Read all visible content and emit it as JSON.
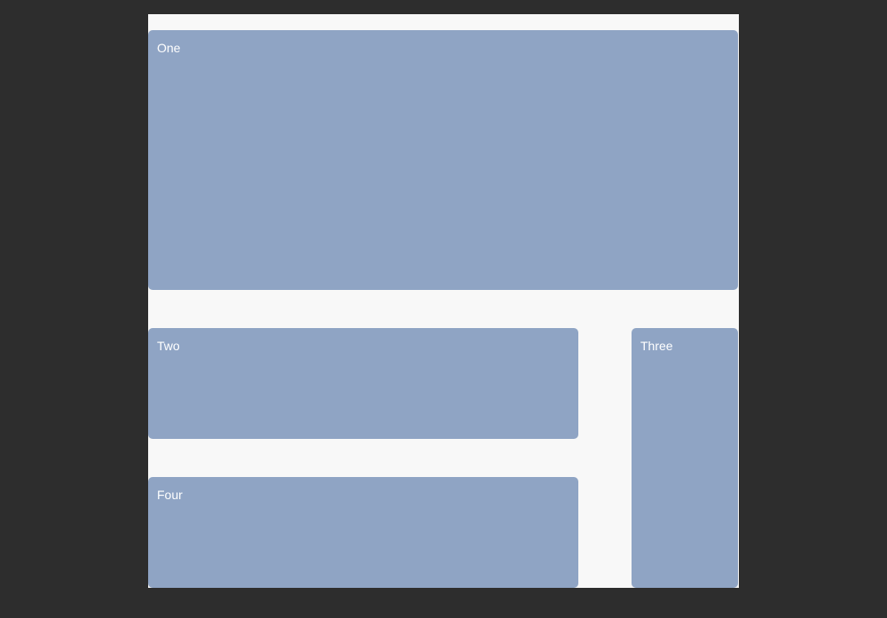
{
  "panels": {
    "one": "One",
    "two": "Two",
    "three": "Three",
    "four": "Four"
  }
}
